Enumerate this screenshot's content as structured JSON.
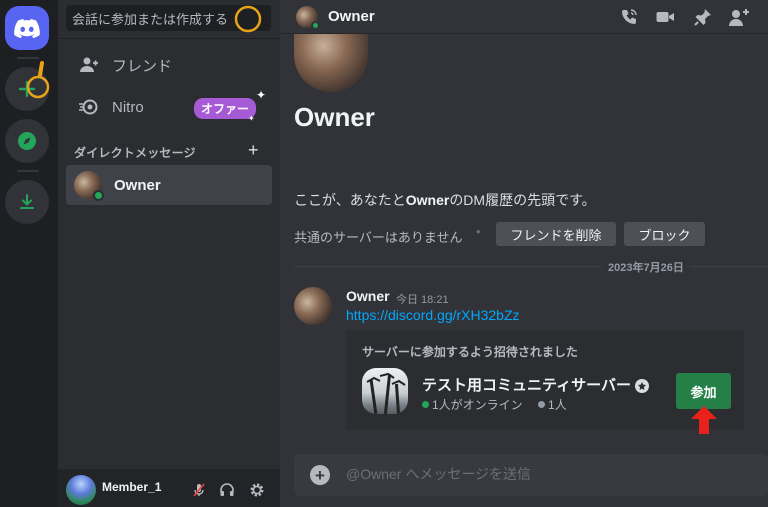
{
  "search": {
    "placeholder": "会話に参加または作成する"
  },
  "sidebar": {
    "friends_label": "フレンド",
    "nitro_label": "Nitro",
    "offer_badge": "オファー",
    "dm_header": "ダイレクトメッセージ",
    "dm_add": "+",
    "dms": [
      {
        "name": "Owner",
        "status": "online"
      }
    ]
  },
  "user_panel": {
    "name": "Member_1"
  },
  "topbar": {
    "name": "Owner"
  },
  "profile": {
    "name": "Owner",
    "intro_prefix": "ここが、あなたと",
    "intro_name": "Owner",
    "intro_suffix": "のDM履歴の先頭です。",
    "mutual": "共通のサーバーはありません",
    "separator": "•",
    "remove_friend": "フレンドを削除",
    "block": "ブロック"
  },
  "date_divider": "2023年7月26日",
  "message": {
    "author": "Owner",
    "time": "今日 18:21",
    "link": "https://discord.gg/rXH32bZz"
  },
  "invite": {
    "heading": "サーバーに参加するよう招待されました",
    "server_name": "テスト用コミュニティサーバー",
    "online": "1人がオンライン",
    "members": "1人",
    "join": "参加"
  },
  "composer": {
    "placeholder": "@Owner へメッセージを送信"
  },
  "colors": {
    "blurple": "#5865f2",
    "green": "#23a55a",
    "join": "#248046",
    "link": "#00a8fc",
    "nitro_badge": "#a65ad6",
    "highlight": "#e8a317",
    "arrow": "#e8211b"
  }
}
